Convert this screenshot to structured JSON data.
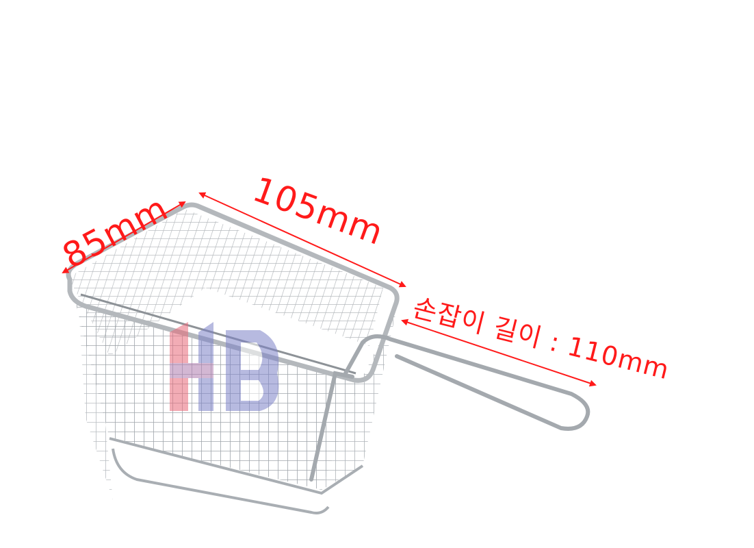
{
  "image": {
    "subject": "stainless-steel-mini-fry-basket-icon",
    "colors": {
      "background": "#ffffff",
      "annotation": "#ff1a1a",
      "steel": "#9ea3a8",
      "logo_red": "#e86a7a",
      "logo_blue": "#7d82c8"
    }
  },
  "dimensions": {
    "width_label": "85mm",
    "length_label": "105mm",
    "handle_label": "손잡이 길이 : 110mm"
  },
  "watermark": {
    "icon": "hd-logo-icon"
  }
}
